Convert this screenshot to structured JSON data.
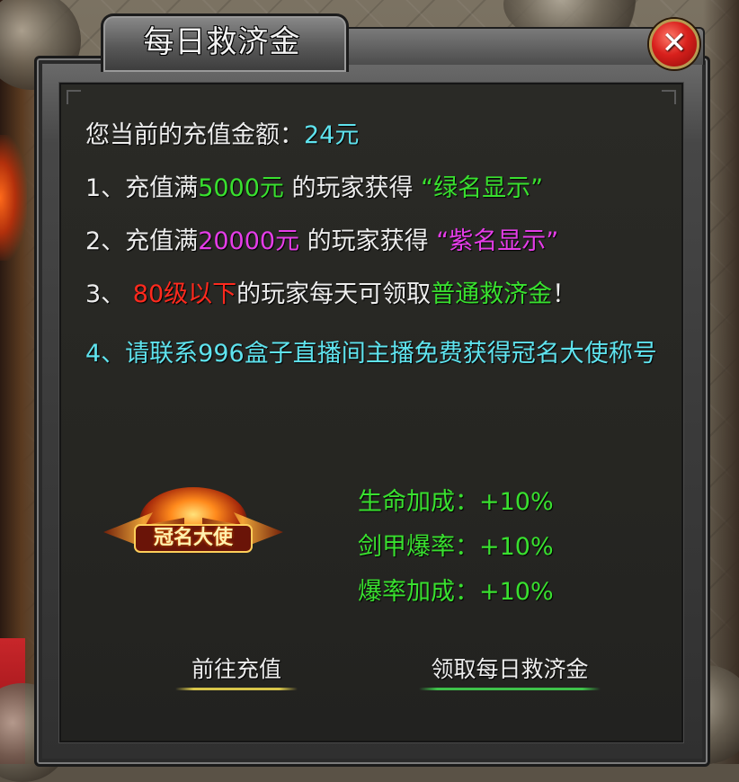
{
  "dialog": {
    "title": "每日救济金",
    "close_label": "✕"
  },
  "info": {
    "balance_label": "您当前的充值金额：",
    "balance_value": "24元",
    "rule1": {
      "prefix": "1、充值满",
      "amount": "5000元",
      "middle": " 的玩家获得 ",
      "reward": "“绿名显示”"
    },
    "rule2": {
      "prefix": "2、充值满",
      "amount": "20000元",
      "middle": " 的玩家获得 ",
      "reward": "“紫名显示”"
    },
    "rule3": {
      "prefix": "3、 ",
      "level": "80级以下",
      "middle": "的玩家每天可领取",
      "reward": "普通救济金",
      "suffix": "！"
    },
    "rule4": "4、请联系996盒子直播间主播免费获得冠名大使称号"
  },
  "badge": {
    "text": "冠名大使"
  },
  "stats": [
    "生命加成：+10%",
    "剑甲爆率：+10%",
    "爆率加成：+10%"
  ],
  "buttons": {
    "recharge": "前往充值",
    "claim": "领取每日救济金"
  },
  "colors": {
    "cyan": "#5fe3ee",
    "green": "#39e02f",
    "magenta": "#e53de8",
    "red": "#ff2a1e"
  }
}
